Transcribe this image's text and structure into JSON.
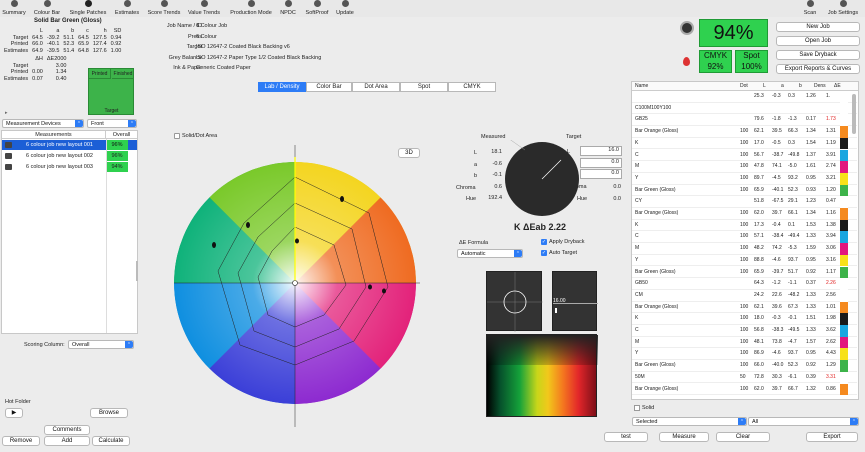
{
  "toolbar": {
    "items": [
      "Summary",
      "Colour Bar",
      "Single Patches",
      "Estimates",
      "Score Trends",
      "Value Trends",
      "Production Mode",
      "NPDC",
      "SoftProof",
      "Update"
    ],
    "right_items": [
      "Scan",
      "Job Settings"
    ]
  },
  "patch": {
    "title": "Solid Bar Green (Gloss)",
    "headers": [
      "L",
      "a",
      "b",
      "c",
      "h",
      "SD"
    ],
    "rows": [
      {
        "label": "Target",
        "values": [
          "64.5",
          "-39.2",
          "51.1",
          "64.5",
          "127.5",
          "0.94"
        ]
      },
      {
        "label": "Printed",
        "values": [
          "66.0",
          "-40.1",
          "52.3",
          "65.9",
          "127.4",
          "0.92"
        ]
      },
      {
        "label": "Estimates",
        "values": [
          "64.9",
          "-39.5",
          "51.4",
          "64.8",
          "127.6",
          "1.00"
        ]
      }
    ],
    "de_headers": [
      "ΔH",
      "ΔE2000"
    ],
    "de_rows": [
      {
        "label": "Target",
        "values": [
          "",
          "3.00"
        ]
      },
      {
        "label": "Printed",
        "values": [
          "0.00",
          "1.34"
        ]
      },
      {
        "label": "Estimates",
        "values": [
          "0.07",
          "0.40"
        ]
      }
    ],
    "printed_label": "Printed",
    "finished_label": "Finished",
    "target_label": "Target",
    "swatch_color": "#3db34a"
  },
  "left": {
    "device_select": "Measurement Devices",
    "side_select": "Front",
    "measurements_header": "Measurements",
    "overall_header": "Overall",
    "measurements": [
      {
        "name": "6 colour job new layout 001",
        "score": "96%",
        "selected": true
      },
      {
        "name": "6 colour job new layout 002",
        "score": "96%",
        "selected": false
      },
      {
        "name": "6 colour job new layout 003",
        "score": "94%",
        "selected": false
      }
    ],
    "scoring_label": "Scoring Column:",
    "scoring_value": "Overall",
    "hot_folder": "Hot Folder",
    "play": "▶",
    "browse": "Browse",
    "comments": "Comments",
    "remove": "Remove",
    "add": "Add",
    "calculate": "Calculate"
  },
  "job": {
    "labels": [
      "Job Name / ID",
      "Press",
      "Target",
      "Grey Balance",
      "Ink & Paper"
    ],
    "values": [
      "6 Colour Job",
      "6 Colour",
      "ISO 12647-2 Coated Black Backing v6",
      "ISO 12647-2 Paper Type 1/2 Coated Black Backing",
      "Generic Coated Paper"
    ]
  },
  "tabs": [
    "Lab / Density",
    "Color Bar",
    "Dot Area",
    "Spot",
    "CMYK"
  ],
  "active_tab": 0,
  "solid_dot_label": "Solid/Dot Area",
  "btn_3d": "3D",
  "lab": {
    "measured_label": "Measured",
    "target_label": "Target",
    "measured": {
      "L": "18.1",
      "a": "-0.6",
      "b": "-0.1",
      "Chroma": "0.6",
      "Hue": "192.4"
    },
    "target": {
      "L": "16.0",
      "a": "0.0",
      "b": "0.0",
      "Chroma": "0.0",
      "Hue": "0.0"
    },
    "labels": [
      "L",
      "a",
      "b",
      "Chroma",
      "Hue"
    ],
    "delta_title": "K ΔEab 2.22"
  },
  "formula": {
    "label": "ΔE Formula",
    "value": "Automatic",
    "apply_dryback": "Apply Dryback",
    "auto_target": "Auto Target"
  },
  "readout": {
    "value": "16.00"
  },
  "score": {
    "overall": "94%",
    "cmyk_label": "CMYK",
    "cmyk_value": "92%",
    "spot_label": "Spot",
    "spot_value": "100%"
  },
  "actions": {
    "new_job": "New Job",
    "open_job": "Open Job",
    "save_dryback": "Save Dryback",
    "export_reports": "Export Reports & Curves"
  },
  "patches_table": {
    "headers": [
      "Name",
      "Dot",
      "L",
      "a",
      "b",
      "Dens",
      "ΔE"
    ],
    "rows": [
      {
        "name": "",
        "dot": "",
        "L": "25.3",
        "a": "-0.3",
        "b": "0.3",
        "d": "1.26",
        "e": "1.",
        "color": "#ffffff"
      },
      {
        "name": "C100M100Y100",
        "dot": "",
        "L": "",
        "a": "",
        "b": "",
        "d": "",
        "e": "",
        "color": "#ffffff"
      },
      {
        "name": "GB25",
        "dot": "",
        "L": "79.6",
        "a": "-1.8",
        "b": "-1.3",
        "d": "0.17",
        "e": "1.73",
        "color": "#ffffff",
        "red": true
      },
      {
        "name": "Bar Orange (Gloss)",
        "dot": "100",
        "L": "62.1",
        "a": "39.5",
        "b": "66.3",
        "d": "1.34",
        "e": "1.31",
        "color": "#f58a1f"
      },
      {
        "name": "K",
        "dot": "100",
        "L": "17.0",
        "a": "-0.5",
        "b": "0.3",
        "d": "1.54",
        "e": "1.19",
        "color": "#1a1a1a"
      },
      {
        "name": "C",
        "dot": "100",
        "L": "56.7",
        "a": "-38.7",
        "b": "-49.8",
        "d": "1.37",
        "e": "3.91",
        "color": "#1aa6e0"
      },
      {
        "name": "M",
        "dot": "100",
        "L": "47.8",
        "a": "74.1",
        "b": "-5.0",
        "d": "1.61",
        "e": "2.74",
        "color": "#e2177e"
      },
      {
        "name": "Y",
        "dot": "100",
        "L": "89.7",
        "a": "-4.5",
        "b": "93.2",
        "d": "0.95",
        "e": "3.21",
        "color": "#f7e11a"
      },
      {
        "name": "Bar Green (Gloss)",
        "dot": "100",
        "L": "65.9",
        "a": "-40.1",
        "b": "52.3",
        "d": "0.93",
        "e": "1.20",
        "color": "#3db34a"
      },
      {
        "name": "CY",
        "dot": "",
        "L": "51.8",
        "a": "-67.5",
        "b": "29.1",
        "d": "1.23",
        "e": "0.47",
        "color": "#ffffff"
      },
      {
        "name": "Bar Orange (Gloss)",
        "dot": "100",
        "L": "62.0",
        "a": "39.7",
        "b": "66.1",
        "d": "1.34",
        "e": "1.16",
        "color": "#f58a1f"
      },
      {
        "name": "K",
        "dot": "100",
        "L": "17.3",
        "a": "-0.4",
        "b": "0.1",
        "d": "1.53",
        "e": "1.38",
        "color": "#1a1a1a"
      },
      {
        "name": "C",
        "dot": "100",
        "L": "57.1",
        "a": "-38.4",
        "b": "-49.4",
        "d": "1.33",
        "e": "3.94",
        "color": "#1aa6e0"
      },
      {
        "name": "M",
        "dot": "100",
        "L": "48.2",
        "a": "74.2",
        "b": "-5.3",
        "d": "1.59",
        "e": "3.06",
        "color": "#e2177e"
      },
      {
        "name": "Y",
        "dot": "100",
        "L": "88.8",
        "a": "-4.6",
        "b": "93.7",
        "d": "0.95",
        "e": "3.16",
        "color": "#f7e11a"
      },
      {
        "name": "Bar Green (Gloss)",
        "dot": "100",
        "L": "65.9",
        "a": "-39.7",
        "b": "51.7",
        "d": "0.92",
        "e": "1.17",
        "color": "#3db34a"
      },
      {
        "name": "GB50",
        "dot": "",
        "L": "64.3",
        "a": "-1.2",
        "b": "-1.1",
        "d": "0.37",
        "e": "2.26",
        "color": "#ffffff",
        "red": true
      },
      {
        "name": "CM",
        "dot": "",
        "L": "24.2",
        "a": "22.6",
        "b": "-48.2",
        "d": "1.33",
        "e": "2.56",
        "color": "#ffffff"
      },
      {
        "name": "Bar Orange (Gloss)",
        "dot": "100",
        "L": "62.1",
        "a": "39.6",
        "b": "67.3",
        "d": "1.33",
        "e": "1.01",
        "color": "#f58a1f"
      },
      {
        "name": "K",
        "dot": "100",
        "L": "18.0",
        "a": "-0.3",
        "b": "-0.1",
        "d": "1.51",
        "e": "1.98",
        "color": "#1a1a1a"
      },
      {
        "name": "C",
        "dot": "100",
        "L": "56.8",
        "a": "-38.3",
        "b": "-49.5",
        "d": "1.33",
        "e": "3.62",
        "color": "#1aa6e0"
      },
      {
        "name": "M",
        "dot": "100",
        "L": "48.1",
        "a": "73.8",
        "b": "-4.7",
        "d": "1.57",
        "e": "2.62",
        "color": "#e2177e"
      },
      {
        "name": "Y",
        "dot": "100",
        "L": "86.9",
        "a": "-4.6",
        "b": "93.7",
        "d": "0.95",
        "e": "4.43",
        "color": "#f7e11a"
      },
      {
        "name": "Bar Green (Gloss)",
        "dot": "100",
        "L": "66.0",
        "a": "-40.0",
        "b": "52.3",
        "d": "0.92",
        "e": "1.29",
        "color": "#3db34a"
      },
      {
        "name": "50M",
        "dot": "50",
        "L": "72.8",
        "a": "30.3",
        "b": "-6.1",
        "d": "0.39",
        "e": "3.31",
        "color": "#ffffff",
        "red": true
      },
      {
        "name": "Bar Orange (Gloss)",
        "dot": "100",
        "L": "62.0",
        "a": "39.7",
        "b": "66.7",
        "d": "1.32",
        "e": "0.86",
        "color": "#f58a1f"
      }
    ]
  },
  "bottom_right": {
    "solid_label": "Solid",
    "selected": "Selected",
    "all": "All",
    "test": "test",
    "measure": "Measure",
    "clear": "Clear",
    "export": "Export"
  },
  "colors": {
    "accent": "#2d7cf6",
    "score_green": "#2fd14f",
    "selected_row": "#1c5fd6"
  }
}
